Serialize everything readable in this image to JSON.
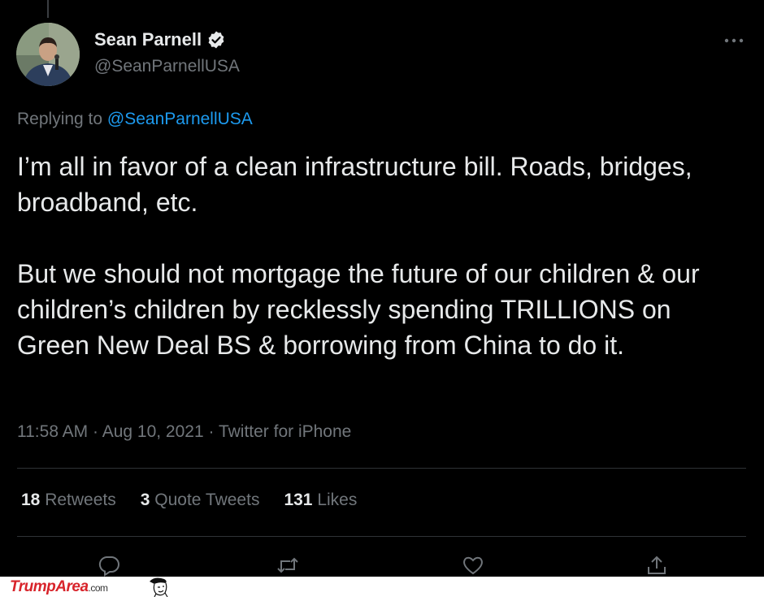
{
  "author": {
    "name": "Sean Parnell",
    "handle": "@SeanParnellUSA",
    "verified_icon": "verified-badge-icon"
  },
  "reply": {
    "prefix": "Replying to ",
    "mention": "@SeanParnellUSA"
  },
  "tweet": {
    "paragraph_1": "I’m all in favor of a clean infrastructure bill. Roads, bridges, broadband, etc.",
    "paragraph_2": "But we should not mortgage the future of our children & our children’s children by recklessly spending TRILLIONS on Green New Deal BS & borrowing from China to do it."
  },
  "meta": {
    "time": "11:58 AM",
    "date": "Aug 10, 2021",
    "source": "Twitter for iPhone",
    "separator": " · "
  },
  "stats": {
    "retweets_count": "18",
    "retweets_label": " Retweets",
    "quotes_count": "3",
    "quotes_label": " Quote Tweets",
    "likes_count": "131",
    "likes_label": " Likes"
  },
  "actions": [
    "reply-icon",
    "retweet-icon",
    "like-icon",
    "share-icon"
  ],
  "watermark": {
    "brand": "TrumpArea",
    "suffix": ".com"
  },
  "colors": {
    "background": "#000000",
    "text": "#e7e9ea",
    "muted": "#71767b",
    "link": "#1d9bf0",
    "watermark_red": "#d8242b"
  }
}
